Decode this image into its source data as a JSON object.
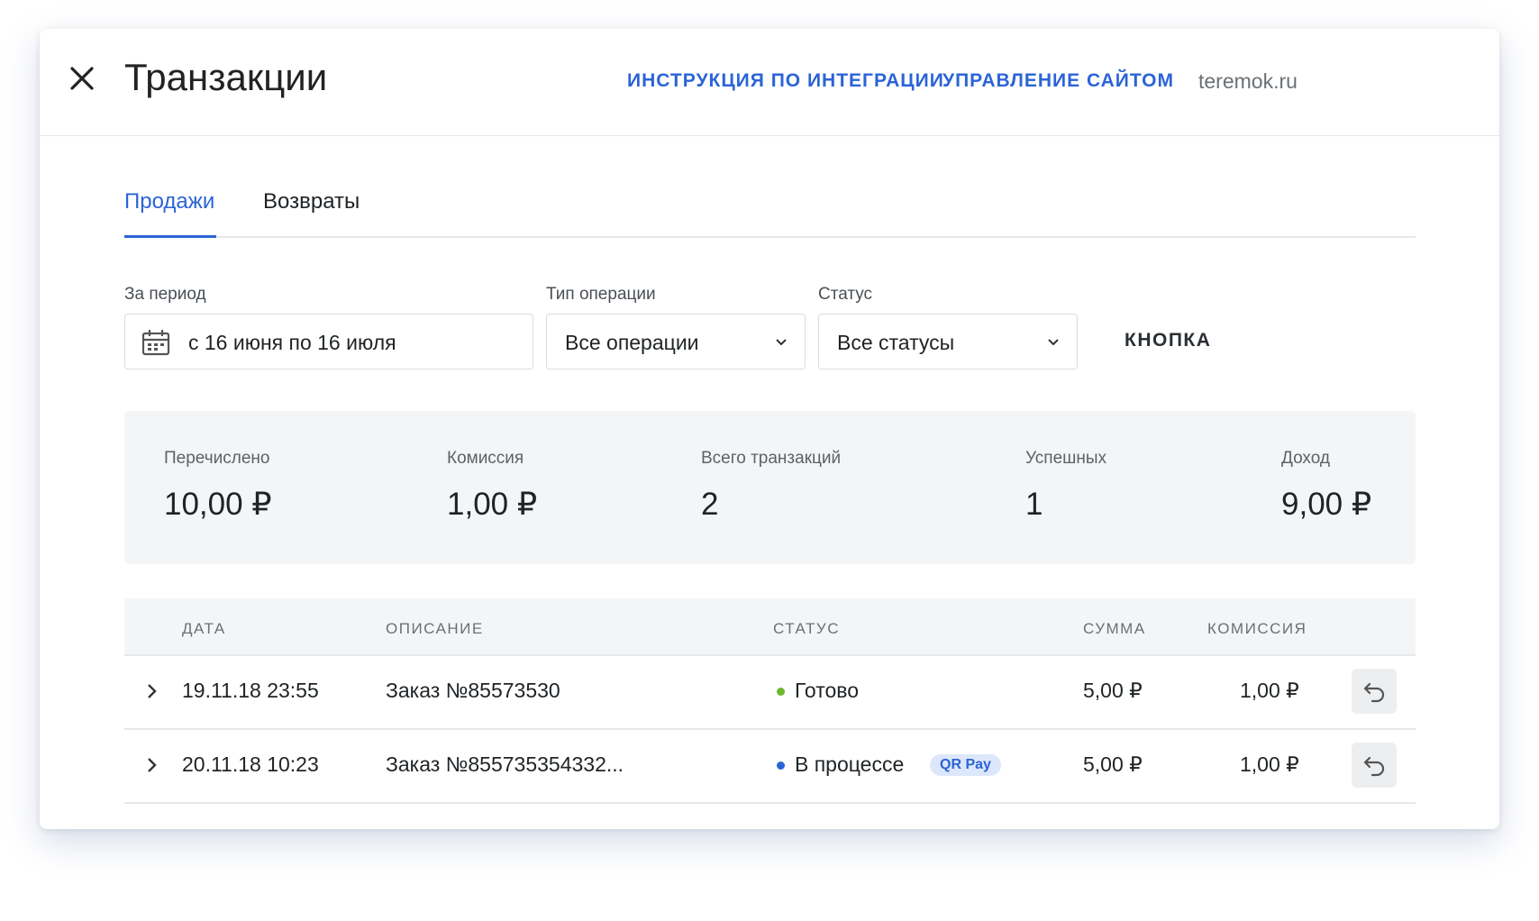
{
  "header": {
    "title": "Транзакции",
    "links": [
      "ИНСТРУКЦИЯ ПО ИНТЕГРАЦИИ",
      "УПРАВЛЕНИЕ САЙТОМ"
    ],
    "site": "teremok.ru"
  },
  "tabs": [
    {
      "label": "Продажи",
      "active": true
    },
    {
      "label": "Возвраты",
      "active": false
    }
  ],
  "filters": {
    "period": {
      "label": "За период",
      "value": "с 16 июня по 16 июля",
      "icon": "calendar-icon"
    },
    "operation": {
      "label": "Тип операции",
      "value": "Все операции"
    },
    "status": {
      "label": "Статус",
      "value": "Все статусы"
    },
    "button": "КНОПКА"
  },
  "summary": [
    {
      "label": "Перечислено",
      "value": "10,00 ₽"
    },
    {
      "label": "Комиссия",
      "value": "1,00 ₽"
    },
    {
      "label": "Всего транзакций",
      "value": "2"
    },
    {
      "label": "Успешных",
      "value": "1"
    },
    {
      "label": "Доход",
      "value": "9,00 ₽"
    }
  ],
  "table": {
    "columns": [
      "ДАТА",
      "ОПИСАНИЕ",
      "СТАТУС",
      "СУММА",
      "КОМИССИЯ"
    ],
    "rows": [
      {
        "date": "19.11.18 23:55",
        "description": "Заказ №85573530",
        "status": "Готово",
        "status_color": "#6bb82e",
        "tag": "",
        "amount": "5,00 ₽",
        "commission": "1,00 ₽"
      },
      {
        "date": "20.11.18 10:23",
        "description": "Заказ №855735354332...",
        "status": "В процессе",
        "status_color": "#2b64d6",
        "tag": "QR Pay",
        "amount": "5,00 ₽",
        "commission": "1,00 ₽"
      }
    ]
  },
  "colors": {
    "accent": "#2b64d6",
    "success": "#6bb82e"
  }
}
